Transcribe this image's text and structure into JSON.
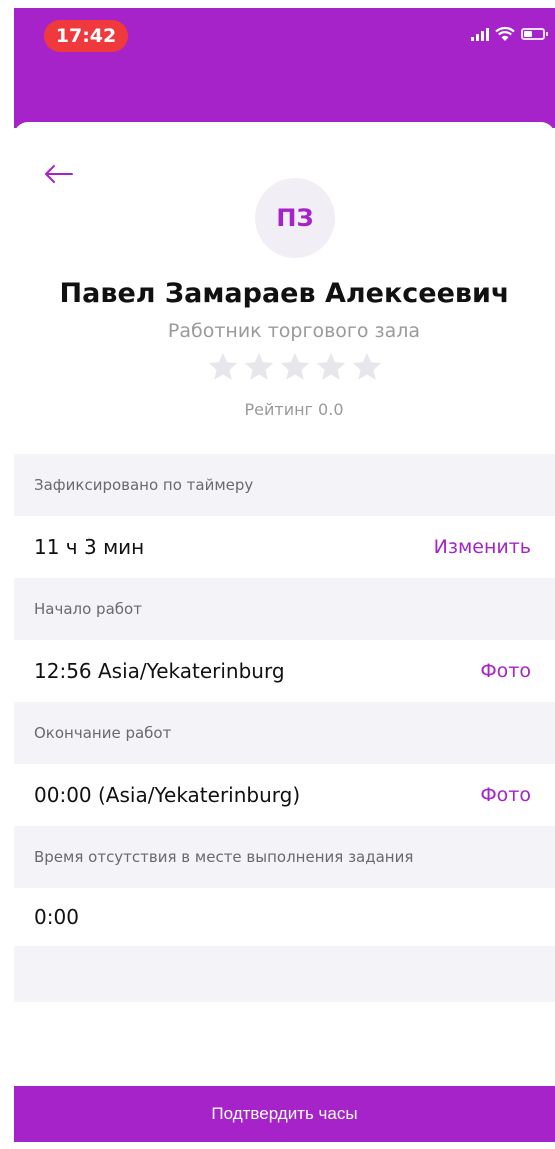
{
  "status_bar": {
    "time": "17:42"
  },
  "profile": {
    "initials": "ПЗ",
    "name": "Павел Замараев Алексеевич",
    "role": "Работник торгового зала",
    "rating_value": 0,
    "rating_max": 5,
    "rating_label": "Рейтинг 0.0"
  },
  "sections": {
    "timer": {
      "label": "Зафиксировано по таймеру",
      "value": "11 ч 3 мин",
      "action": "Изменить"
    },
    "start": {
      "label": "Начало работ",
      "value": "12:56 Asia/Yekaterinburg",
      "action": "Фото"
    },
    "end": {
      "label": "Окончание работ",
      "value": "00:00 (Asia/Yekaterinburg)",
      "action": "Фото"
    },
    "absence": {
      "label": "Время отсутствия в месте выполнения задания",
      "value": "0:00"
    }
  },
  "footer": {
    "confirm_label": "Подтвердить часы"
  },
  "colors": {
    "accent": "#a523c9",
    "time_pill": "#f0393c",
    "section_bg": "#f4f3f7"
  }
}
